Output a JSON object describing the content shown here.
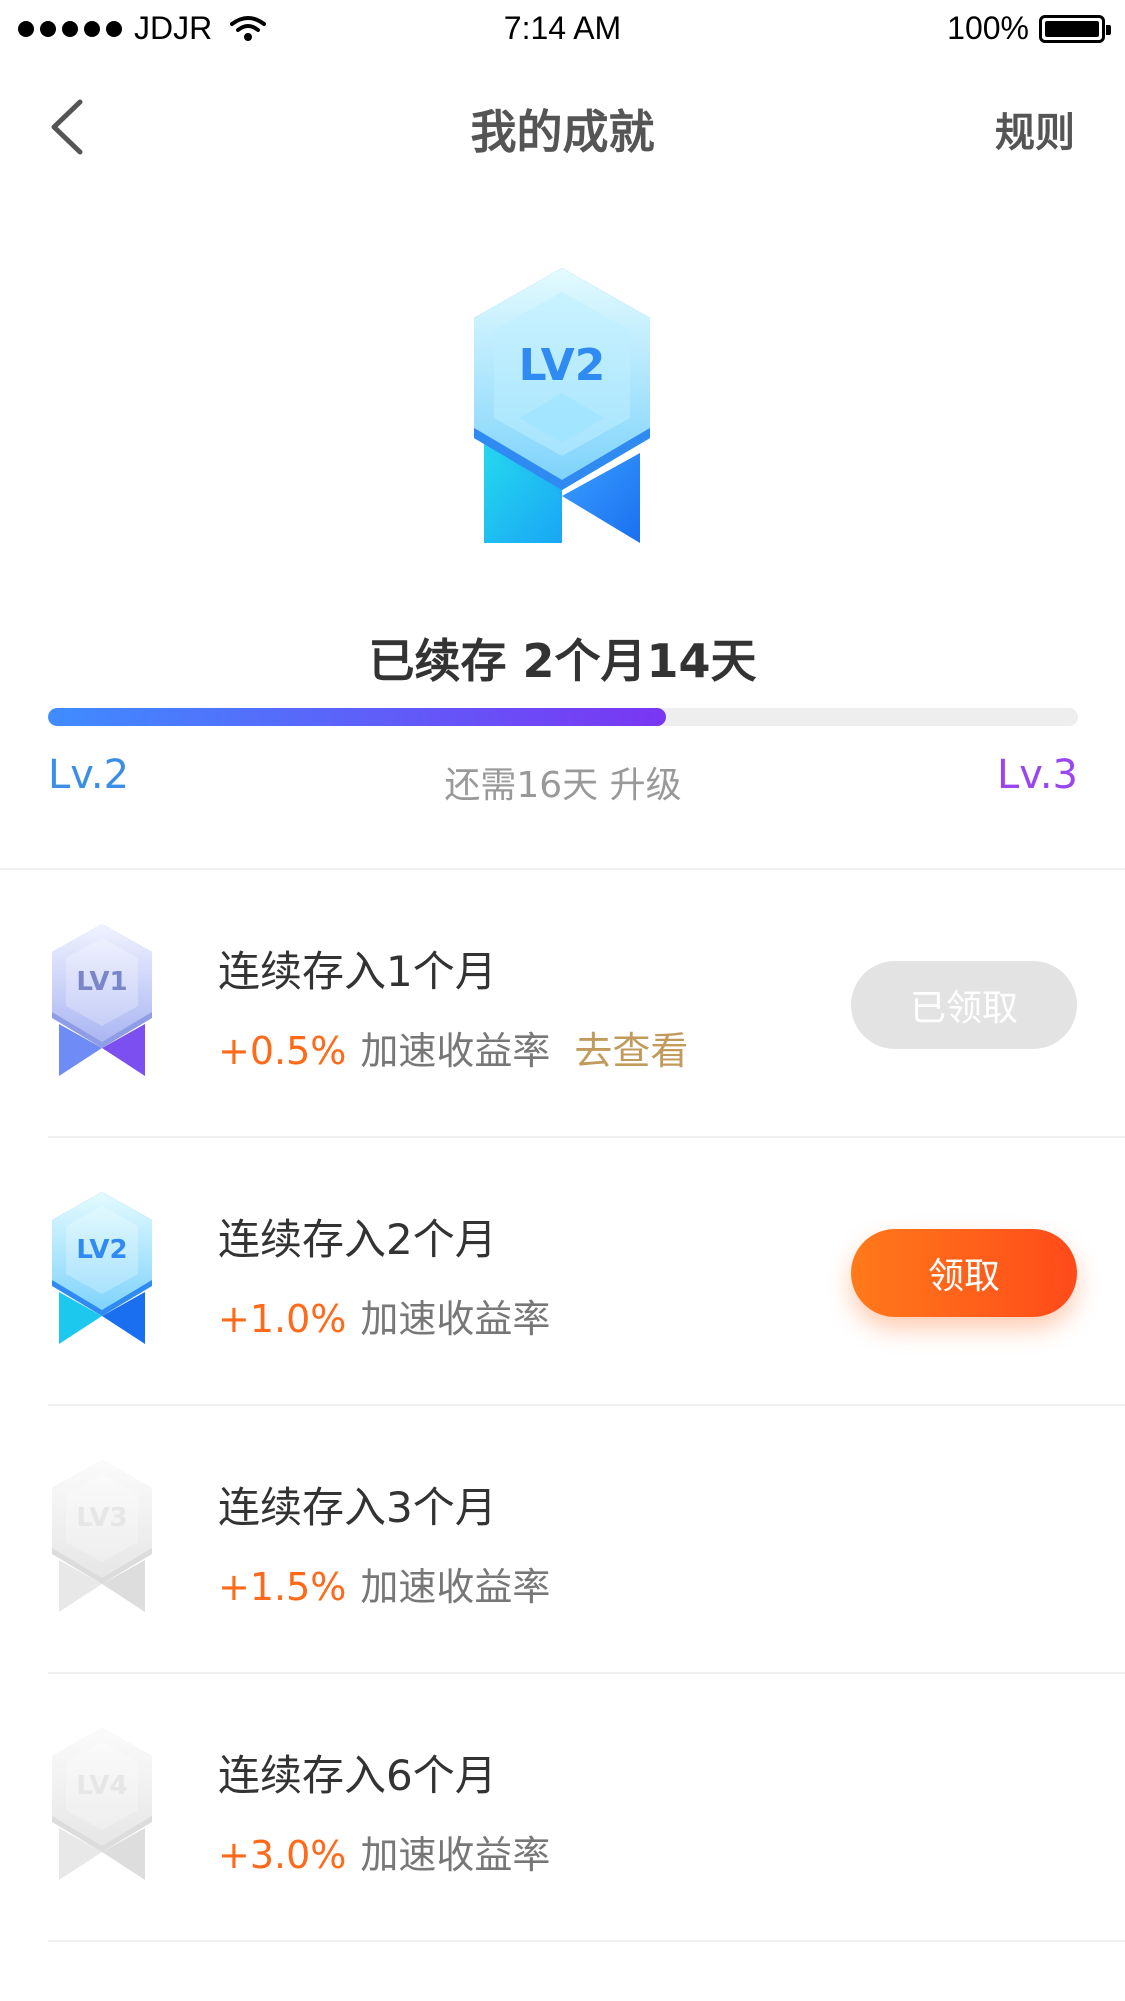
{
  "status_bar": {
    "carrier": "JDJR",
    "time": "7:14 AM",
    "battery": "100%"
  },
  "nav": {
    "title": "我的成就",
    "rules_label": "规则"
  },
  "hero": {
    "badge_label": "LV2",
    "streak_text": "已续存 2个月14天",
    "progress_percent": 60,
    "current_level": "Lv.2",
    "next_level": "Lv.3",
    "need_text": "还需16天 升级"
  },
  "achievements": [
    {
      "badge_label": "LV1",
      "badge_style": "lv1",
      "title": "连续存入1个月",
      "rate": "+0.5%",
      "description": "加速收益率",
      "link": "去查看",
      "button": "已领取",
      "button_state": "claimed"
    },
    {
      "badge_label": "LV2",
      "badge_style": "lv2",
      "title": "连续存入2个月",
      "rate": "+1.0%",
      "description": "加速收益率",
      "link": "",
      "button": "领取",
      "button_state": "active"
    },
    {
      "badge_label": "LV3",
      "badge_style": "locked",
      "title": "连续存入3个月",
      "rate": "+1.5%",
      "description": "加速收益率",
      "link": "",
      "button": "",
      "button_state": "none"
    },
    {
      "badge_label": "LV4",
      "badge_style": "locked",
      "title": "连续存入6个月",
      "rate": "+3.0%",
      "description": "加速收益率",
      "link": "",
      "button": "",
      "button_state": "none"
    }
  ],
  "colors": {
    "accent_orange": "#ff6a1a",
    "level_blue": "#3a8ee6",
    "level_purple": "#9a46ee",
    "link_gold": "#c29a5c"
  }
}
